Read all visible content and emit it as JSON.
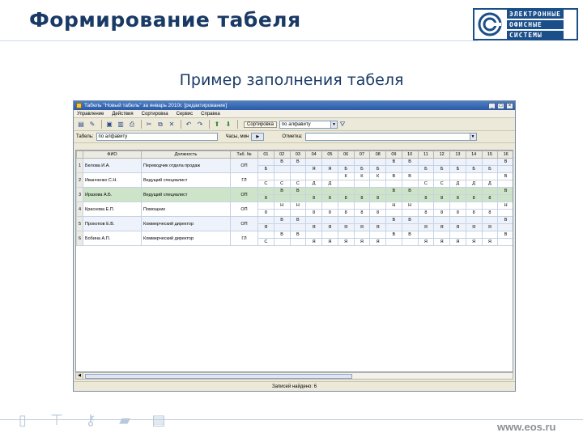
{
  "slide": {
    "title": "Формирование табеля",
    "subtitle": "Пример заполнения табеля",
    "logo_lines": [
      "ЭЛЕКТРОННЫЕ",
      "ОФИСНЫЕ",
      "СИСТЕМЫ"
    ],
    "footer_url": "www.eos.ru",
    "footer_icons": [
      "document-icon",
      "org-chart-icon",
      "key-icon",
      "folder-icon",
      "doc-stack-icon"
    ]
  },
  "window": {
    "title": "Табель \"Новый табель\" за январь 2010г. [редактирование]",
    "menu": [
      "Управление",
      "Действия",
      "Сортировка",
      "Сервис",
      "Справка"
    ],
    "sort_label": "Сортировка",
    "sort_value": "по алфавиту",
    "filter": {
      "label": "Табель:",
      "value": "по алфавиту",
      "hours_label": "Часы, мин",
      "type_label": "Отметка:"
    },
    "status": "Записей найдено: 6",
    "colors": {
      "selected_row": "#cde4c8",
      "row_alt": "#eef3fb",
      "titlebar": "#2a5aa6"
    }
  },
  "grid": {
    "headers": [
      "",
      "ФИО",
      "Должность",
      "Таб. №",
      "01",
      "02",
      "03",
      "04",
      "05",
      "06",
      "07",
      "08",
      "09",
      "10",
      "11",
      "12",
      "13",
      "14",
      "15",
      "16"
    ],
    "rows": [
      {
        "num": "1",
        "name": "Белова И.А.",
        "position": "Переводчик отдела продаж",
        "tab": "ОП",
        "line1": [
          "",
          "В",
          "В",
          "",
          "",
          "",
          "",
          "",
          "В",
          "В",
          "",
          "",
          "",
          "",
          "",
          "В"
        ],
        "line2": [
          "Б",
          "",
          "",
          "Я",
          "Я",
          "Б",
          "Б",
          "Б",
          "",
          "",
          "Б",
          "Б",
          "Б",
          "Б",
          "Б",
          ""
        ]
      },
      {
        "num": "2",
        "name": "Иванченко С.Н.",
        "position": "Ведущий специалист",
        "tab": "ГЛ",
        "line1": [
          "",
          "",
          "",
          "",
          "",
          "К",
          "К",
          "К",
          "В",
          "В",
          "",
          "",
          "",
          "",
          "",
          "В"
        ],
        "line2": [
          "С",
          "С",
          "С",
          "Д",
          "Д",
          "",
          "",
          "",
          "",
          "",
          "С",
          "С",
          "Д",
          "Д",
          "Д",
          ""
        ]
      },
      {
        "num": "3",
        "name": "Иразова А.Б.",
        "position": "Ведущий специалист",
        "tab": "ОП",
        "line1": [
          "",
          "В",
          "В",
          "",
          "",
          "",
          "",
          "",
          "В",
          "В",
          "",
          "",
          "",
          "",
          "",
          "В"
        ],
        "line2": [
          "8",
          "",
          "",
          "8",
          "8",
          "8",
          "8",
          "8",
          "",
          "",
          "8",
          "8",
          "8",
          "8",
          "8",
          ""
        ]
      },
      {
        "num": "4",
        "name": "Краснова Е.П.",
        "position": "Помощник",
        "tab": "ОП",
        "line1": [
          "",
          "Н",
          "Н",
          "",
          "",
          "",
          "",
          "",
          "Н",
          "Н",
          "",
          "",
          "",
          "",
          "",
          "Н"
        ],
        "line2": [
          "8",
          "",
          "",
          "8",
          "8",
          "8",
          "8",
          "8",
          "",
          "",
          "8",
          "8",
          "8",
          "8",
          "8",
          ""
        ]
      },
      {
        "num": "5",
        "name": "Прокопов Е.В.",
        "position": "Коммерческий директор",
        "tab": "ОП",
        "line1": [
          "",
          "В",
          "В",
          "",
          "",
          "",
          "",
          "",
          "В",
          "В",
          "",
          "",
          "",
          "",
          "",
          "В"
        ],
        "line2": [
          "Я",
          "",
          "",
          "Я",
          "Я",
          "Я",
          "Я",
          "Я",
          "",
          "",
          "Я",
          "Я",
          "Я",
          "Я",
          "Я",
          ""
        ]
      },
      {
        "num": "6",
        "name": "Бобина А.П.",
        "position": "Коммерческий директор",
        "tab": "ГЛ",
        "line1": [
          "",
          "В",
          "В",
          "",
          "",
          "",
          "",
          "",
          "В",
          "В",
          "",
          "",
          "",
          "",
          "",
          "В"
        ],
        "line2": [
          "С",
          "",
          "",
          "Я",
          "Я",
          "Я",
          "Я",
          "Я",
          "",
          "",
          "Я",
          "Я",
          "Я",
          "Я",
          "Я",
          ""
        ]
      }
    ]
  }
}
